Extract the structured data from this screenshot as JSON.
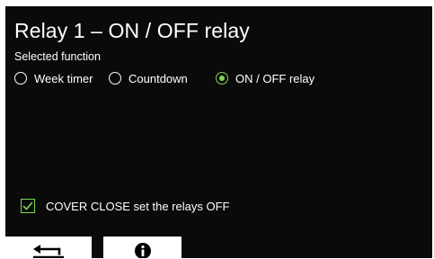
{
  "title": "Relay 1 – ON / OFF relay",
  "function_label": "Selected function",
  "functions": [
    {
      "label": "Week timer",
      "selected": false
    },
    {
      "label": "Countdown",
      "selected": false
    },
    {
      "label": "ON / OFF relay",
      "selected": true
    }
  ],
  "cover_close": {
    "label": "COVER CLOSE set the relays OFF",
    "checked": true
  },
  "toolbar": {
    "back_icon": "return-arrow-icon",
    "info_icon": "info-icon"
  },
  "colors": {
    "background": "#0a0a0a",
    "accent": "#7ed957",
    "text": "#ffffff",
    "button": "#ffffff"
  }
}
